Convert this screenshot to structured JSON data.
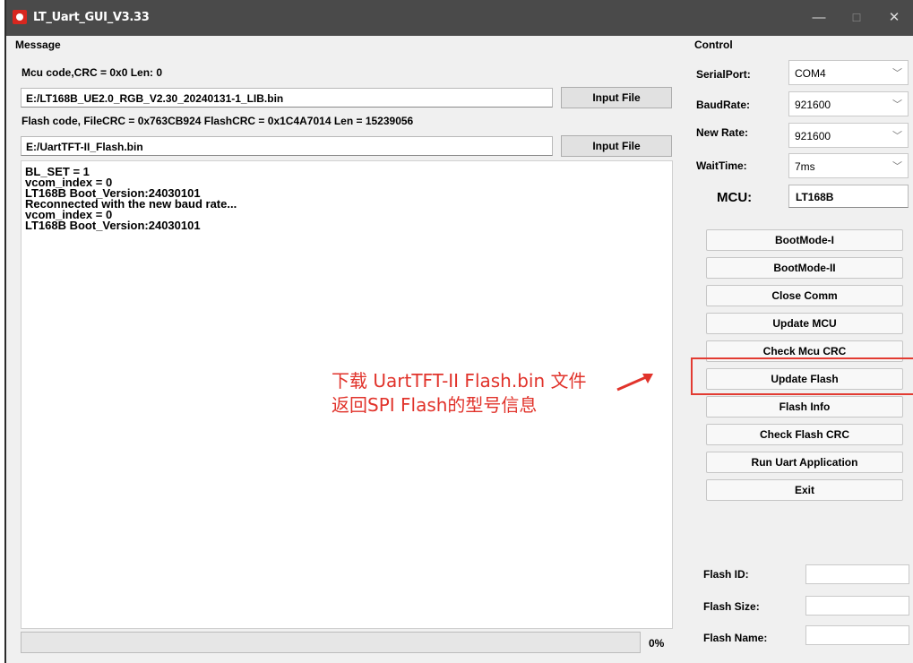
{
  "window": {
    "title": "LT_Uart_GUI_V3.33",
    "controls": {
      "minimize": "—",
      "maximize": "☐",
      "close": "✕"
    }
  },
  "message": {
    "group_title": "Message",
    "mcu_info": "Mcu code,CRC = 0x0  Len: 0",
    "mcu_file_path": "E:/LT168B_UE2.0_RGB_V2.30_20240131-1_LIB.bin",
    "input_file_button": "Input File",
    "flash_info": "Flash code, FileCRC = 0x763CB924  FlashCRC = 0x1C4A7014  Len = 15239056",
    "flash_file_path": "E:/UartTFT-II_Flash.bin",
    "input_file_button_2": "Input File",
    "log_lines": [
      "BL_SET = 1",
      "vcom_index = 0",
      "LT168B Boot_Version:24030101",
      "Reconnected with the new baud rate...",
      "vcom_index = 0",
      "LT168B Boot_Version:24030101"
    ],
    "progress_percent": "0%",
    "progress_value": 0
  },
  "control": {
    "group_title": "Control",
    "serial_port": {
      "label": "SerialPort:",
      "value": "COM4"
    },
    "baud_rate": {
      "label": "BaudRate:",
      "value": "921600"
    },
    "new_rate": {
      "label": "New Rate:",
      "value": "921600"
    },
    "wait_time": {
      "label": "WaitTime:",
      "value": "7ms"
    },
    "mcu": {
      "label": "MCU:",
      "value": "LT168B"
    },
    "buttons": [
      "BootMode-I",
      "BootMode-II",
      "Close Comm",
      "Update MCU",
      "Check Mcu CRC",
      "Update Flash",
      "Flash Info",
      "Check Flash CRC",
      "Run Uart Application",
      "Exit"
    ],
    "flash_id": {
      "label": "Flash ID:",
      "value": ""
    },
    "flash_size": {
      "label": "Flash Size:",
      "value": ""
    },
    "flash_name": {
      "label": "Flash Name:",
      "value": ""
    }
  },
  "annotation": {
    "line1": "下载 UartTFT-II Flash.bin 文件",
    "line2": "返回SPI Flash的型号信息",
    "color": "#e1332b"
  },
  "icons": [
    "app-icon",
    "minimize-icon",
    "maximize-icon",
    "close-icon",
    "chevron-down-icon",
    "arrow-icon"
  ]
}
